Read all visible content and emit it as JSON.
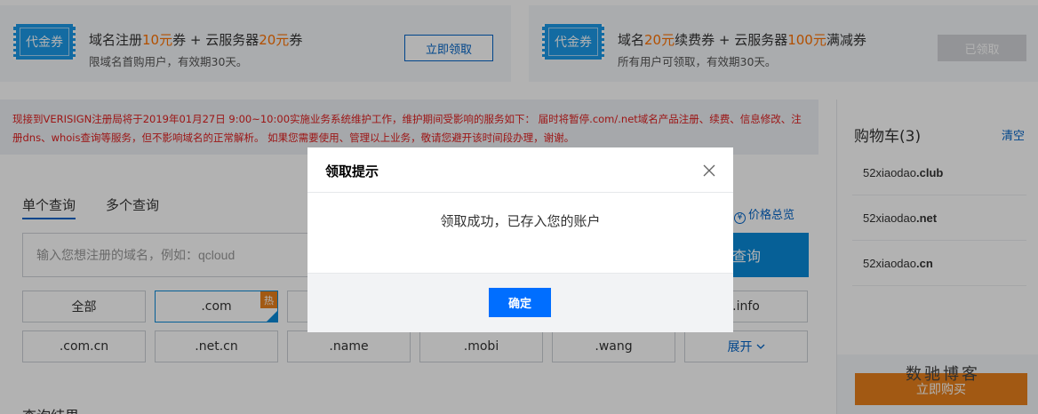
{
  "coupons": [
    {
      "badge": "代金券",
      "title_parts": [
        "域名注册",
        "10元",
        "券 + 云服务器",
        "20元",
        "券"
      ],
      "subtitle": "限域名首购用户，有效期30天。",
      "button": "立即领取"
    },
    {
      "badge": "代金券",
      "title_parts": [
        "域名",
        "20元",
        "续费券 + 云服务器",
        "100元",
        "满减券"
      ],
      "subtitle": "所有用户可领取，有效期30天。",
      "button": "已领取"
    }
  ],
  "notice": {
    "text": "现接到VERISIGN注册局将于2019年01月27日 9:00~10:00实施业务系统维护工作，维护期间受影响的服务如下： 届时将暂停.com/.net域名产品注册、续费、信息修改、注册dns、whois查询等服务，但不影响域名的正常解析。 如果您需要使用、管理以上业务，敬请您避开该时间段办理，谢谢。"
  },
  "search": {
    "tabs": [
      {
        "label": "单个查询"
      },
      {
        "label": "多个查询"
      }
    ],
    "price_overview": "价格总览",
    "placeholder": "输入您想注册的域名，例如：qcloud",
    "button": "查询",
    "suffix_row1": [
      "全部",
      ".com",
      "",
      "",
      "",
      ".info"
    ],
    "suffix_row2": [
      ".com.cn",
      ".net.cn",
      ".name",
      ".mobi",
      ".wang",
      "展开"
    ],
    "hot_badge": "热",
    "results_title": "查询结果"
  },
  "cart": {
    "title": "购物车(3)",
    "clear": "清空",
    "items": [
      {
        "name": "52xiaodao",
        "tld": ".club"
      },
      {
        "name": "52xiaodao",
        "tld": ".net"
      },
      {
        "name": "52xiaodao",
        "tld": ".cn"
      }
    ],
    "buy_button": "立即购买",
    "watermark": "数驰博客"
  },
  "modal": {
    "title": "领取提示",
    "message": "领取成功，已存入您的账户",
    "ok": "确定"
  },
  "colors": {
    "accent": "#006eff",
    "link": "#0064c8",
    "highlight": "#ff7200",
    "notice_text": "#e02020",
    "buy": "#e8801c"
  }
}
